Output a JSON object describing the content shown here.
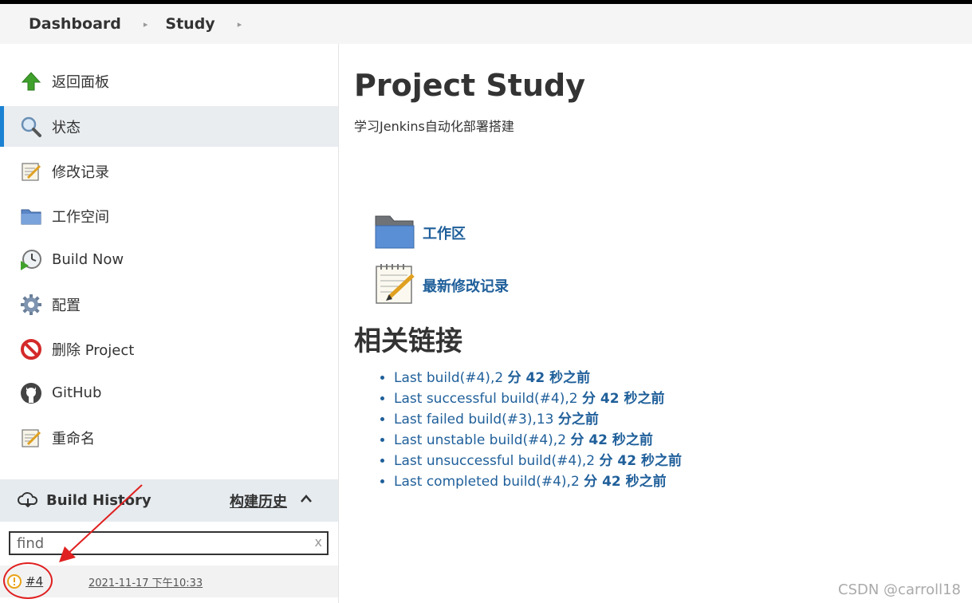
{
  "breadcrumb": {
    "items": [
      {
        "label": "Dashboard"
      },
      {
        "label": "Study"
      }
    ]
  },
  "sidebar": {
    "tasks": [
      {
        "label": "返回面板",
        "icon": "up-arrow-icon",
        "active": false
      },
      {
        "label": "状态",
        "icon": "magnifier-icon",
        "active": true
      },
      {
        "label": "修改记录",
        "icon": "notepad-icon",
        "active": false
      },
      {
        "label": "工作空间",
        "icon": "folder-icon",
        "active": false
      },
      {
        "label": "Build Now",
        "icon": "clock-play-icon",
        "active": false
      },
      {
        "label": "配置",
        "icon": "gear-icon",
        "active": false
      },
      {
        "label": "删除 Project",
        "icon": "no-entry-icon",
        "active": false
      },
      {
        "label": "GitHub",
        "icon": "github-icon",
        "active": false
      },
      {
        "label": "重命名",
        "icon": "notepad-icon",
        "active": false
      }
    ]
  },
  "build_history": {
    "title": "Build History",
    "trend_label": "构建历史",
    "search": {
      "placeholder": "find",
      "clear": "x"
    },
    "builds": [
      {
        "number": "#4",
        "date": "2021-11-17 下午10:33",
        "status": "unstable"
      }
    ]
  },
  "main": {
    "title": "Project Study",
    "description": "学习Jenkins自动化部署搭建",
    "workspace_link": "工作区",
    "changes_link": "最新修改记录",
    "related_title": "相关链接",
    "permalinks": [
      {
        "name": "Last build(#4),2 ",
        "ago": "分 42 秒之前"
      },
      {
        "name": "Last successful build(#4),2 ",
        "ago": "分 42 秒之前"
      },
      {
        "name": "Last failed build(#3),13 ",
        "ago": "分之前"
      },
      {
        "name": "Last unstable build(#4),2 ",
        "ago": "分 42 秒之前"
      },
      {
        "name": "Last unsuccessful build(#4),2 ",
        "ago": "分 42 秒之前"
      },
      {
        "name": "Last completed build(#4),2 ",
        "ago": "分 42 秒之前"
      }
    ]
  },
  "watermark": "CSDN @carroll18",
  "colors": {
    "link": "#1f5f9a",
    "active_accent": "#1b82d3",
    "annotation": "#e02020"
  }
}
